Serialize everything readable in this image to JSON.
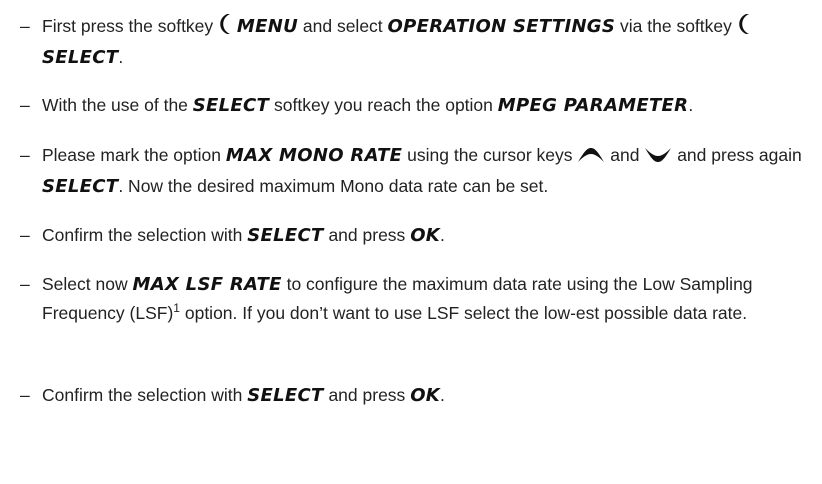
{
  "document": {
    "bullet": "–",
    "steps": [
      {
        "p1": "First press the softkey",
        "k1": "MENU",
        "p2": "and select",
        "k2": "OPERATION SETTINGS",
        "p3": "via the softkey",
        "k3": "SELECT",
        "p4": "."
      },
      {
        "p1": "With the use of the",
        "k1": "SELECT",
        "p2": "softkey you reach the option",
        "k2": "MPEG PARAMETER",
        "p3": "."
      },
      {
        "p1": "Please mark the option",
        "k1": "MAX MONO RATE",
        "p2": "using the cursor keys",
        "p3": "and",
        "p4": "and press again",
        "k2": "SELECT",
        "p5": ". Now the desired maximum Mono data rate can be set."
      },
      {
        "p1": "Confirm the selection with",
        "k1": "SELECT",
        "p2": "and press",
        "k2": "OK",
        "p3": "."
      },
      {
        "p1": "Select now",
        "k1": "MAX LSF RATE",
        "p2": "to configure the maximum data rate using the Low Sampling Frequency (LSF)",
        "sup": "1",
        "p3": "option. If you don’t want to use LSF select the low-est possible data rate."
      },
      {
        "p1": "Confirm the selection with",
        "k1": "SELECT",
        "p2": "and press",
        "k2": "OK",
        "p3": "."
      }
    ]
  }
}
